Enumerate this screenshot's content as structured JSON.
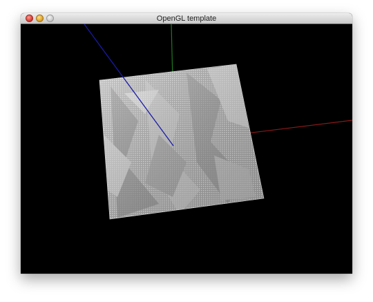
{
  "window": {
    "title": "OpenGL template"
  },
  "controls": {
    "close": "close-button",
    "minimize": "minimize-button",
    "zoom": "zoom-button"
  },
  "scene": {
    "background": "#000000",
    "axis_colors": {
      "x": "#8b1a1a",
      "y": "#1f7a1f",
      "z": "#1a1aa8"
    },
    "surface_color": "#bdbdbd"
  }
}
